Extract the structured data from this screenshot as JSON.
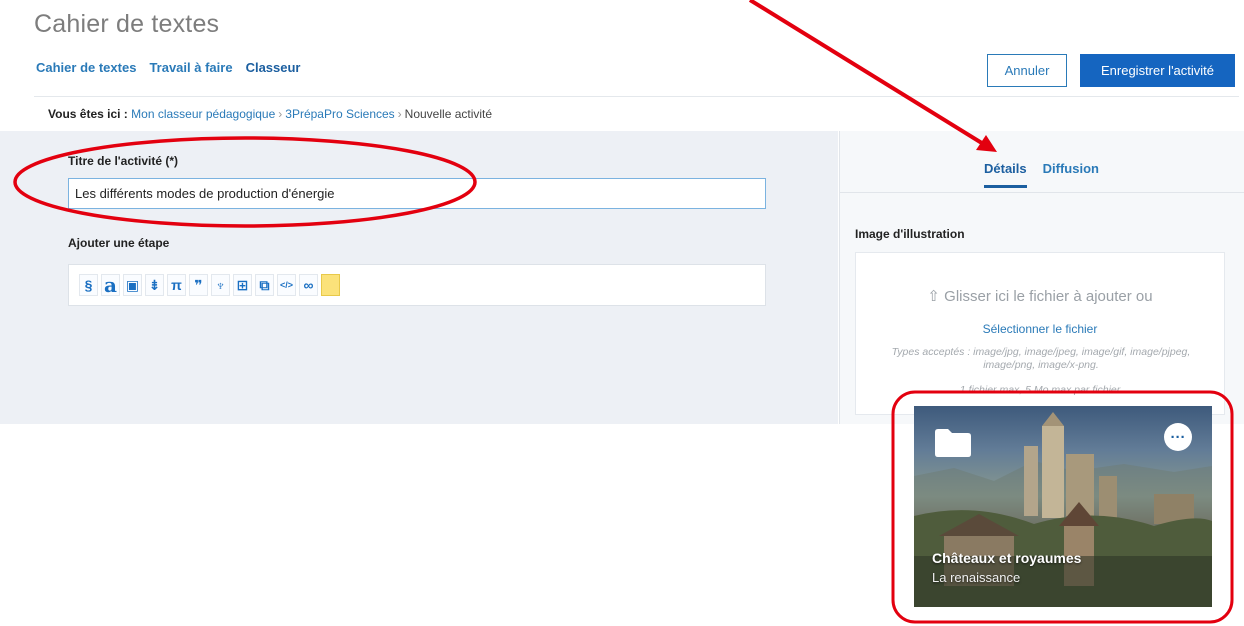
{
  "header": {
    "title": "Cahier de textes",
    "tabs": [
      {
        "label": "Cahier de textes"
      },
      {
        "label": "Travail à faire"
      },
      {
        "label": "Classeur"
      }
    ],
    "cancel_label": "Annuler",
    "save_label": "Enregistrer l'activité"
  },
  "breadcrumb": {
    "prefix": "Vous êtes ici :",
    "items": [
      "Mon classeur pédagogique",
      "3PrépaPro Sciences",
      "Nouvelle activité"
    ],
    "separator": "›"
  },
  "form": {
    "title_label": "Titre de l'activité (*)",
    "title_value": "Les différents modes de production d'énergie",
    "step_label": "Ajouter une étape",
    "tools": [
      {
        "glyph": "§",
        "icon": "paragraph-icon"
      },
      {
        "glyph": "a",
        "icon": "text-icon"
      },
      {
        "glyph": "▣",
        "icon": "image-icon"
      },
      {
        "glyph": "⇟",
        "icon": "file-icon"
      },
      {
        "glyph": "π",
        "icon": "formula-icon"
      },
      {
        "glyph": "❞",
        "icon": "quote-icon"
      },
      {
        "glyph": "♆",
        "icon": "microphone-icon"
      },
      {
        "glyph": "⊞",
        "icon": "layout-icon"
      },
      {
        "glyph": "⧉",
        "icon": "external-icon"
      },
      {
        "glyph": "</>",
        "icon": "embed-code-icon"
      },
      {
        "glyph": "∞",
        "icon": "link-icon"
      },
      {
        "glyph": "",
        "icon": "note-icon"
      }
    ]
  },
  "side": {
    "tabs": [
      {
        "label": "Détails"
      },
      {
        "label": "Diffusion"
      }
    ],
    "image_label": "Image d'illustration",
    "dropzone_text": "⇧ Glisser ici le fichier à ajouter ou",
    "dropzone_link": "Sélectionner le fichier",
    "dropzone_hint": "Types acceptés : image/jpg, image/jpeg, image/gif, image/pjpeg, image/png, image/x-png.",
    "dropzone_limit": "1 fichier max, 5 Mo max par fichier"
  },
  "card": {
    "title": "Châteaux et royaumes",
    "subtitle": "La renaissance",
    "more_label": "···"
  },
  "colors": {
    "accent": "#1565c0",
    "link": "#2a7ab8",
    "annotation": "#e3000f"
  }
}
